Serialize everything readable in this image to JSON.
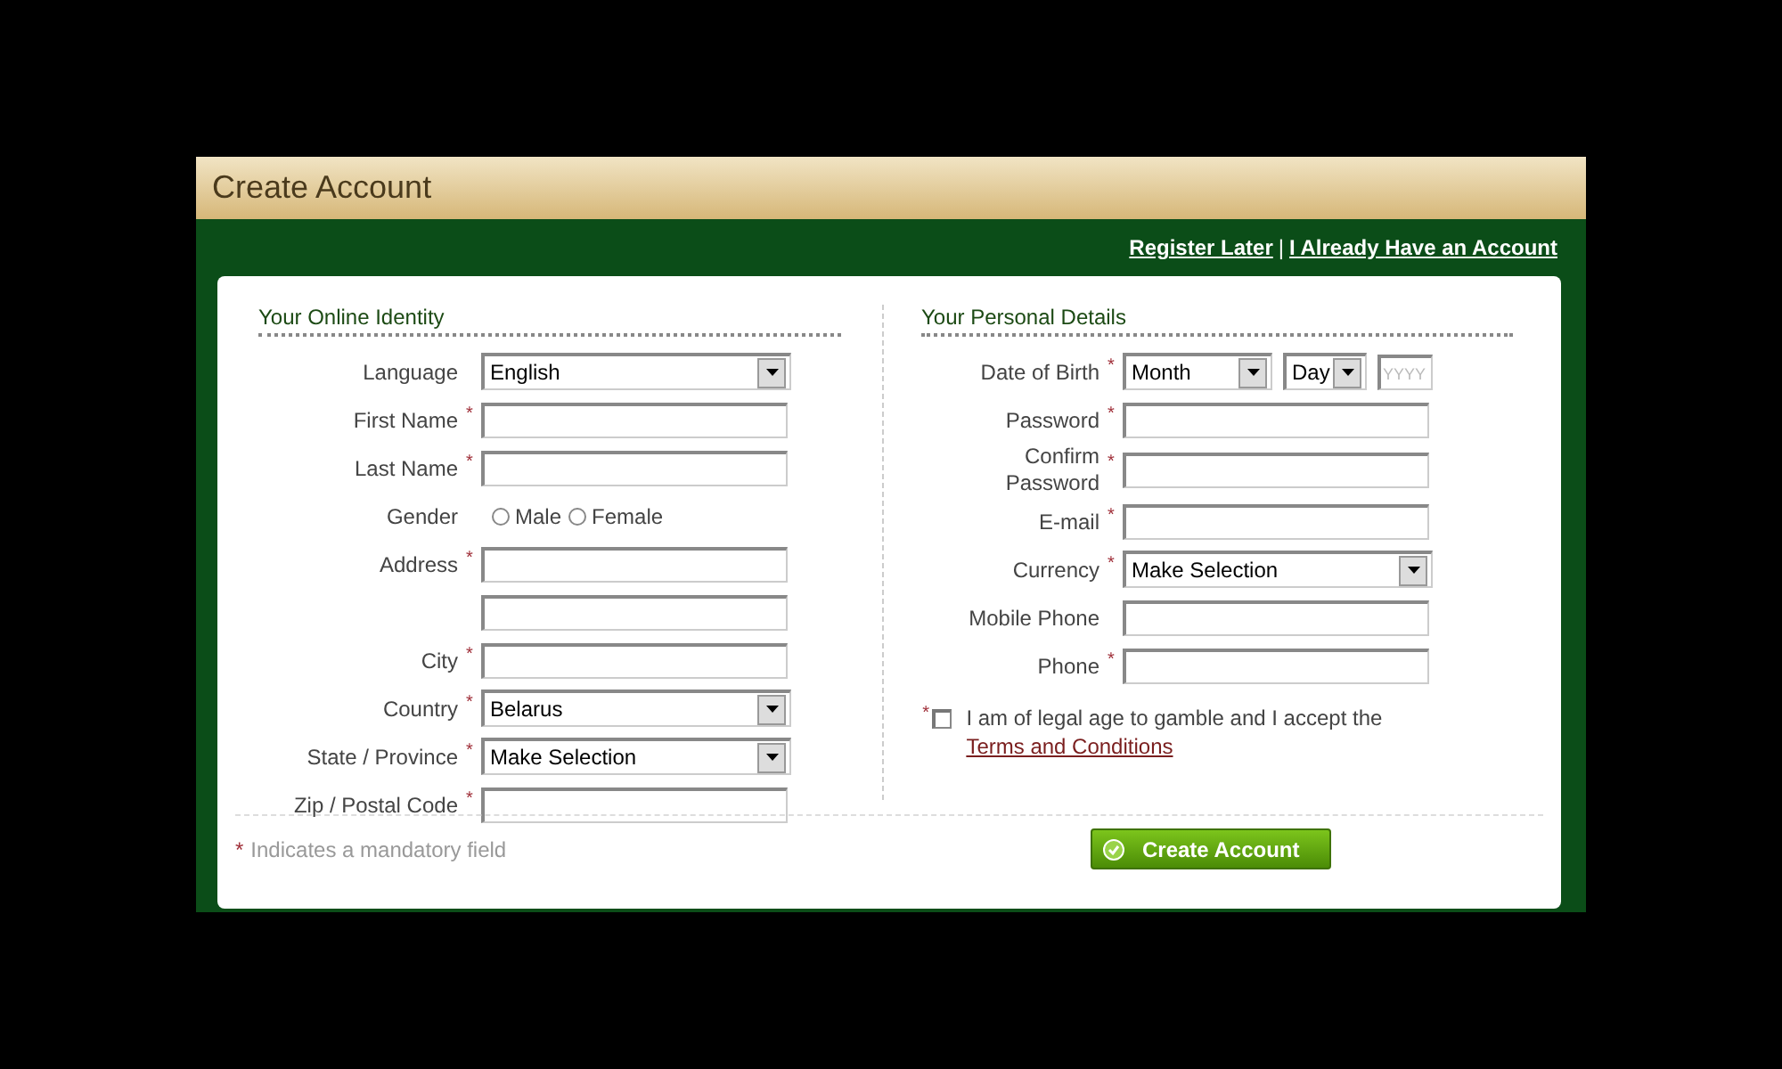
{
  "title": "Create Account",
  "links": [
    {
      "label": "Register Later"
    },
    {
      "label": "I Already Have an Account"
    }
  ],
  "link_separator": "|",
  "left": {
    "heading": "Your Online Identity",
    "fields": [
      {
        "kind": "select",
        "label": "Language",
        "value": "English"
      },
      {
        "kind": "text",
        "label": "First Name",
        "mark": "*"
      },
      {
        "kind": "text",
        "label": "Last Name",
        "mark": "*"
      },
      {
        "kind": "radio",
        "label": "Gender",
        "options": [
          {
            "label": "Male",
            "selected": false
          },
          {
            "label": "Female",
            "selected": false
          }
        ]
      },
      {
        "kind": "text",
        "label": "Address",
        "mark": "*"
      },
      {
        "kind": "text"
      },
      {
        "kind": "text",
        "label": "City",
        "mark": "*"
      },
      {
        "kind": "select",
        "label": "Country",
        "mark": "*",
        "value": "Belarus"
      },
      {
        "kind": "select",
        "label": "State / Province",
        "mark": "*",
        "value": "Make Selection"
      },
      {
        "kind": "text",
        "label": "Zip / Postal Code",
        "mark": "*"
      }
    ]
  },
  "right": {
    "heading": "Your Personal Details",
    "fields": [
      {
        "kind": "date",
        "label": "Date of Birth",
        "mark": "*",
        "month": "Month",
        "day": "Day",
        "year_placeholder": "YYYY"
      },
      {
        "kind": "text",
        "label": "Password",
        "mark": "*"
      },
      {
        "kind": "text",
        "label": "Confirm Password",
        "mark": "*"
      },
      {
        "kind": "text",
        "label": "E-mail",
        "mark": "*"
      },
      {
        "kind": "select",
        "label": "Currency",
        "mark": "*",
        "value": "Make Selection"
      },
      {
        "kind": "text",
        "label": "Mobile Phone"
      },
      {
        "kind": "text",
        "label": "Phone",
        "mark": "*"
      }
    ],
    "agreement": {
      "mark": "*",
      "checked": false,
      "text": "I am of legal age to gamble and I accept the",
      "link": "Terms and Conditions"
    }
  },
  "footer": {
    "mark": "*",
    "note": "Indicates a mandatory field",
    "button": "Create Account"
  }
}
